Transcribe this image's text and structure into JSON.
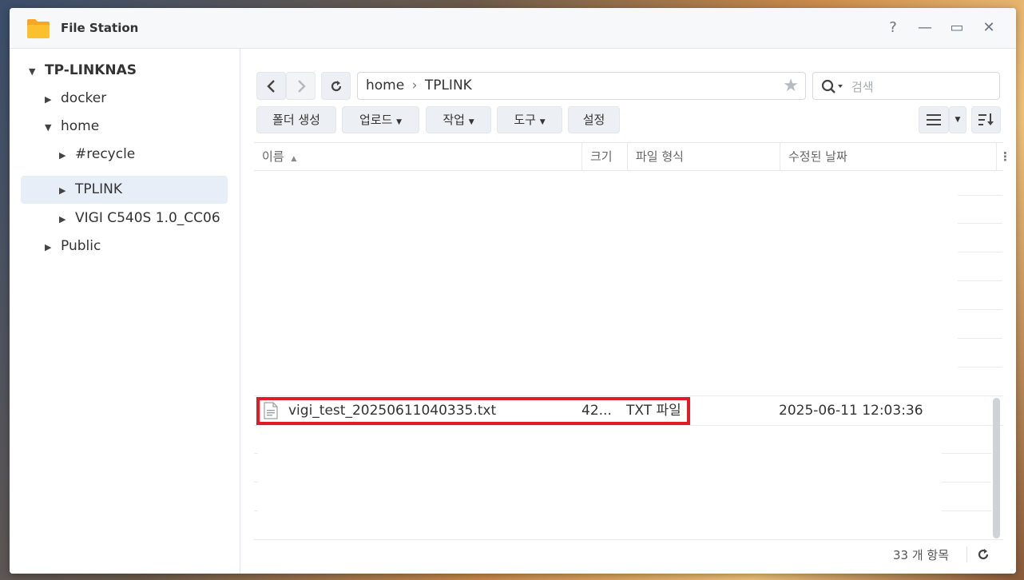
{
  "app": {
    "title": "File Station",
    "controls": {
      "help": "?",
      "minimize": "—",
      "maximize": "▭",
      "close": "✕"
    }
  },
  "sidebar": {
    "items": [
      {
        "label": "TP-LINKNAS",
        "expanded": true
      },
      {
        "label": "docker",
        "expanded": false
      },
      {
        "label": "home",
        "expanded": true
      },
      {
        "label": "#recycle",
        "expanded": false
      },
      {
        "label": "TPLINK",
        "expanded": false,
        "selected": true
      },
      {
        "label": "VIGI C540S 1.0_CC06",
        "expanded": false
      },
      {
        "label": "Public",
        "expanded": false
      }
    ]
  },
  "toolbar": {
    "path": [
      "home",
      "TPLINK"
    ],
    "path_separator": "›",
    "search_placeholder": "검색",
    "buttons": {
      "new_folder": "폴더 생성",
      "upload": "업로드",
      "action": "작업",
      "tools": "도구",
      "settings": "설정"
    }
  },
  "grid": {
    "columns": [
      "이름",
      "크기",
      "파일 형식",
      "수정된 날짜"
    ],
    "sort_indicator": "▲",
    "rows": [
      {
        "name": "vigi_test_20250611040335.txt",
        "size": "42...",
        "type": "TXT 파일",
        "modified": "2025-06-11 12:03:36"
      }
    ],
    "item_count": "33 개 항목"
  },
  "colors": {
    "accent": "#e01b24",
    "selected_bg": "#e8eef8",
    "folder": "#f5a623"
  }
}
